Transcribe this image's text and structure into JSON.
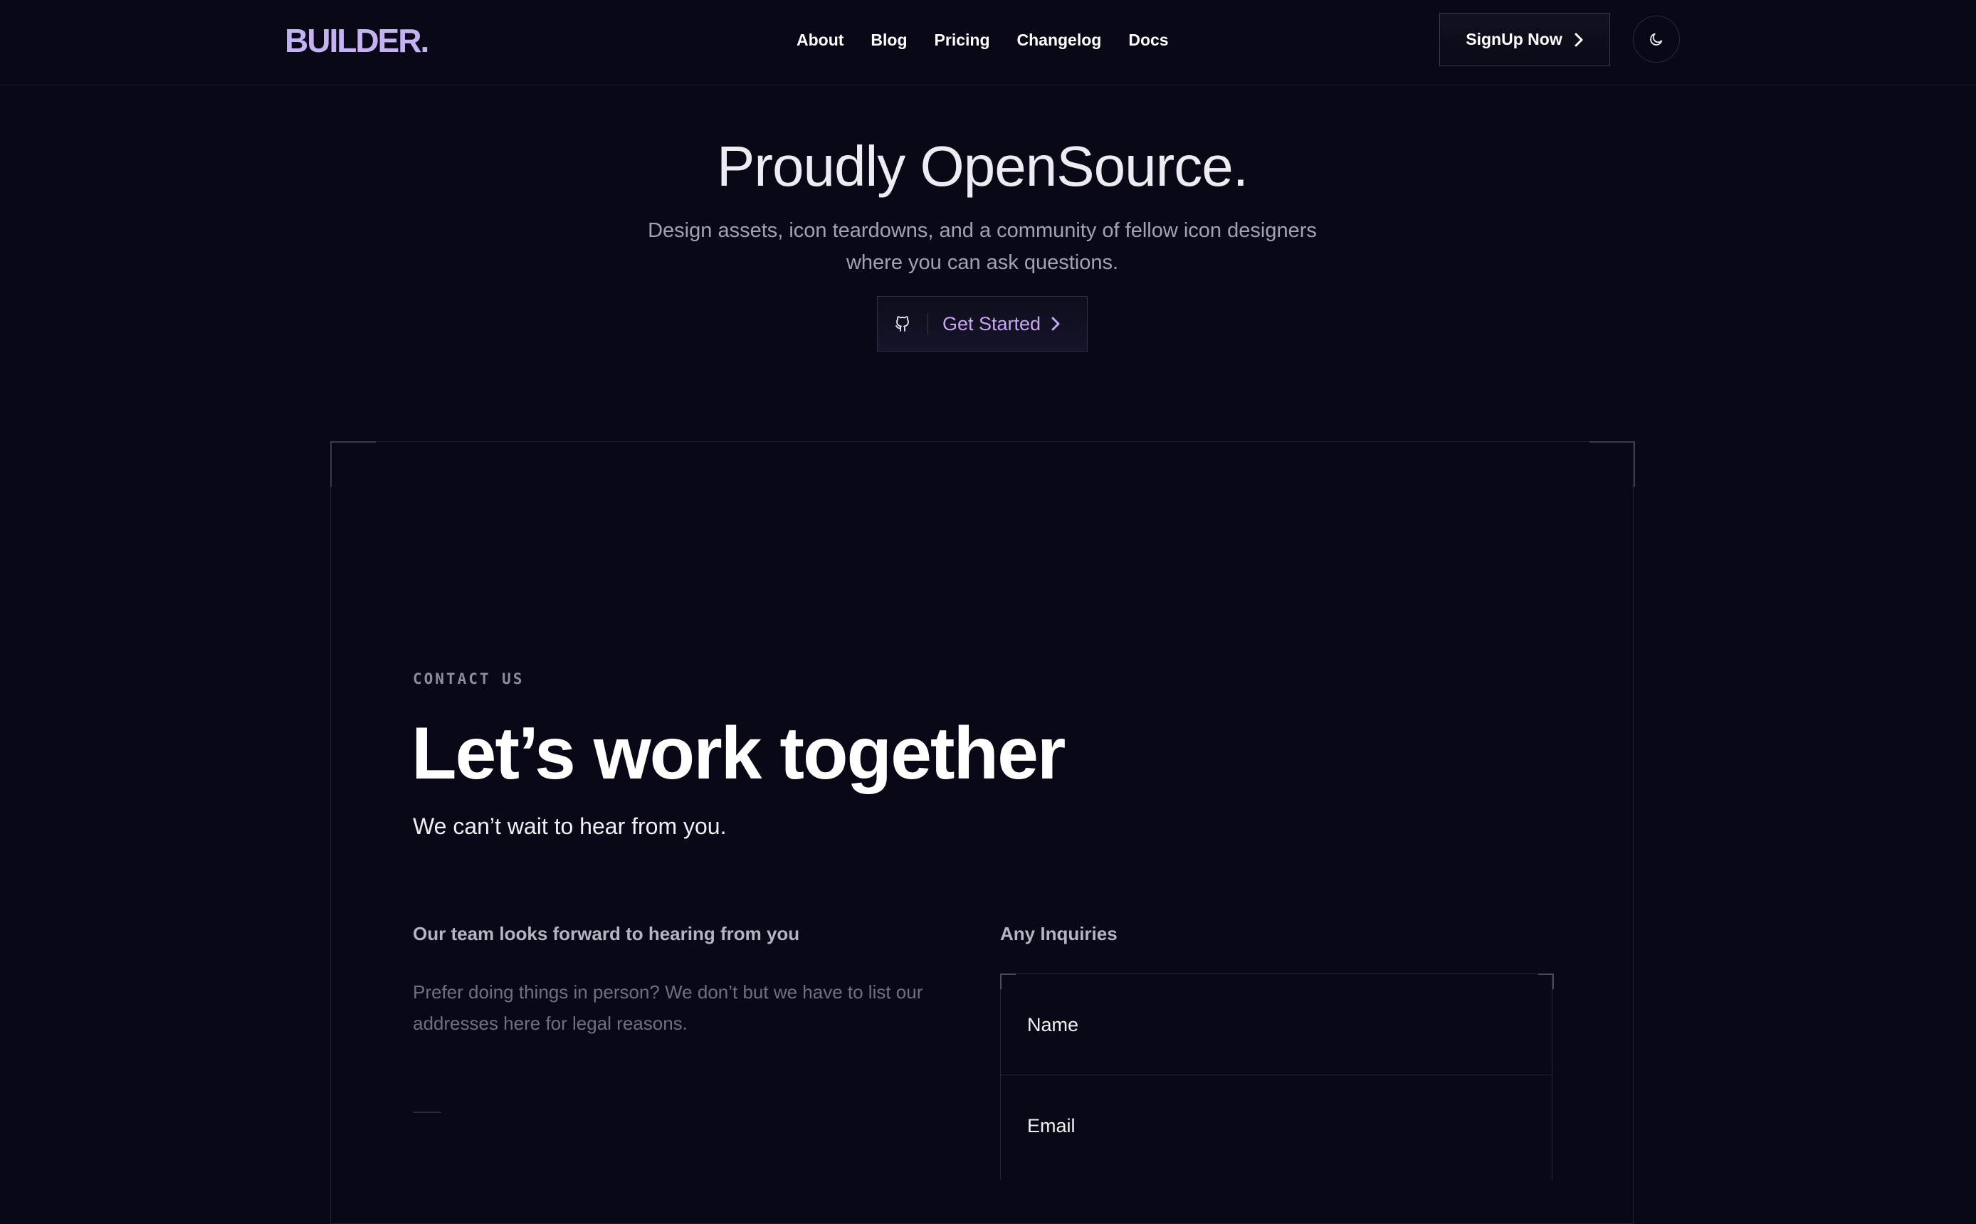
{
  "header": {
    "logo": "BUILDER.",
    "nav": [
      "About",
      "Blog",
      "Pricing",
      "Changelog",
      "Docs"
    ],
    "signup_label": "SignUp Now",
    "theme_icon": "moon-icon"
  },
  "hero": {
    "title": "Proudly OpenSource.",
    "subtitle_line1": "Design assets, icon teardowns, and a community of fellow icon designers",
    "subtitle_line2": "where you can ask questions.",
    "cta_label": "Get Started",
    "cta_icon": "github-icon"
  },
  "contact": {
    "eyebrow": "CONTACT US",
    "heading": "Let’s work together",
    "tagline": "We can’t wait to hear from you.",
    "left_heading": "Our team looks forward to hearing from you",
    "left_text": "Prefer doing things in person? We don’t but we have to list our addresses here for legal reasons.",
    "right_heading": "Any Inquiries",
    "fields": [
      "Name",
      "Email"
    ]
  },
  "colors": {
    "background": "#080816",
    "logo": "#c4b2f2",
    "accent": "#c6a6f0"
  }
}
